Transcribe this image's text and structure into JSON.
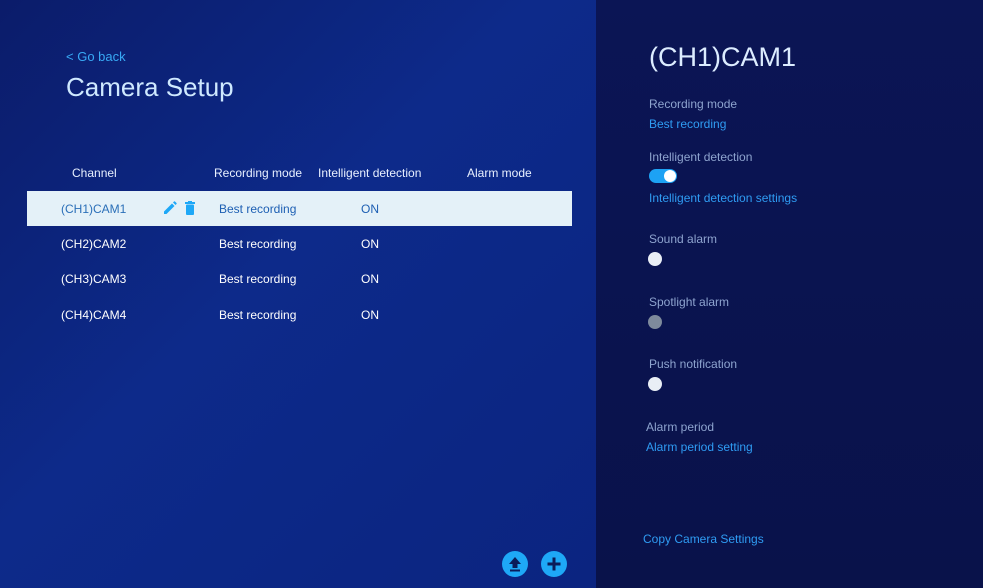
{
  "header": {
    "back_label": "< Go back",
    "title": "Camera Setup"
  },
  "table": {
    "columns": [
      "Channel",
      "Recording mode",
      "Intelligent detection",
      "Alarm mode"
    ],
    "rows": [
      {
        "channel": "(CH1)CAM1",
        "recording_mode": "Best recording",
        "intelligent_detection": "ON",
        "alarm_mode": "",
        "selected": true
      },
      {
        "channel": "(CH2)CAM2",
        "recording_mode": "Best recording",
        "intelligent_detection": "ON",
        "alarm_mode": "",
        "selected": false
      },
      {
        "channel": "(CH3)CAM3",
        "recording_mode": "Best recording",
        "intelligent_detection": "ON",
        "alarm_mode": "",
        "selected": false
      },
      {
        "channel": "(CH4)CAM4",
        "recording_mode": "Best recording",
        "intelligent_detection": "ON",
        "alarm_mode": "",
        "selected": false
      }
    ]
  },
  "actions": {
    "upload_icon": "upload-icon",
    "add_icon": "plus-icon"
  },
  "detail": {
    "title": "(CH1)CAM1",
    "recording_mode_label": "Recording mode",
    "recording_mode_value": "Best recording",
    "intelligent_detection_label": "Intelligent detection",
    "intelligent_detection_on": true,
    "intelligent_detection_settings": "Intelligent detection settings",
    "sound_alarm_label": "Sound alarm",
    "spotlight_alarm_label": "Spotlight alarm",
    "push_notification_label": "Push notification",
    "alarm_period_label": "Alarm period",
    "alarm_period_setting": "Alarm period setting",
    "copy_settings": "Copy Camera Settings"
  },
  "colors": {
    "accent": "#1ea8f7",
    "link": "#2f9cf3",
    "selected_row_bg": "#e4f1f8"
  }
}
